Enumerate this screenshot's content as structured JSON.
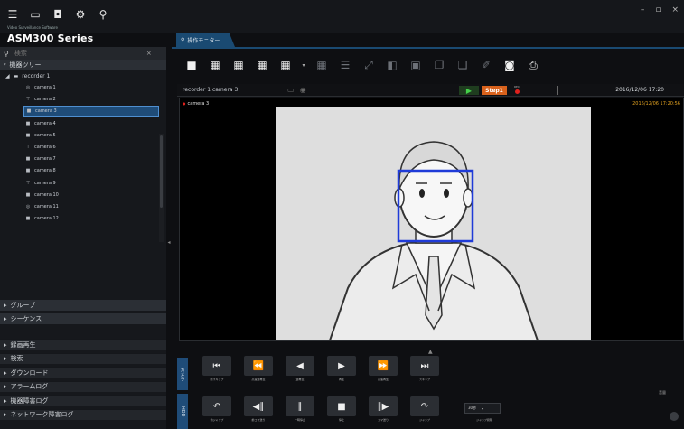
{
  "header": {
    "brand_sub": "Video Surveillance Software",
    "brand": "ASM300 Series",
    "top_icons": [
      "menu-icon",
      "monitor-icon",
      "camera-view-icon",
      "settings-icon",
      "search-icon"
    ],
    "window_controls": [
      "–",
      "▫",
      "×"
    ]
  },
  "left_panel": {
    "search_placeholder": "検索",
    "tree_header": "機器ツリー",
    "recorder": "recorder 1",
    "cameras": [
      {
        "label": "camera 1",
        "icon": "dome-camera-icon",
        "glyph": "◎"
      },
      {
        "label": "camera 2",
        "icon": "bullet-camera-icon",
        "glyph": "⊤"
      },
      {
        "label": "camera 3",
        "icon": "box-camera-icon",
        "glyph": "■",
        "selected": true
      },
      {
        "label": "camera 4",
        "icon": "box-camera-icon",
        "glyph": "■"
      },
      {
        "label": "camera 5",
        "icon": "box-camera-icon",
        "glyph": "■"
      },
      {
        "label": "camera 6",
        "icon": "bullet-camera-icon",
        "glyph": "⊤"
      },
      {
        "label": "camera 7",
        "icon": "box-camera-icon",
        "glyph": "■"
      },
      {
        "label": "camera 8",
        "icon": "box-camera-icon",
        "glyph": "■"
      },
      {
        "label": "camera 9",
        "icon": "bullet-camera-icon",
        "glyph": "⊤"
      },
      {
        "label": "camera 10",
        "icon": "box-camera-icon",
        "glyph": "■"
      },
      {
        "label": "camera 11",
        "icon": "dome-camera-icon",
        "glyph": "◎"
      },
      {
        "label": "camera 12",
        "icon": "box-camera-icon",
        "glyph": "■"
      }
    ],
    "sections": [
      "グループ",
      "シーケンス"
    ],
    "menu": [
      "録画再生",
      "検索",
      "ダウンロード",
      "アラームログ",
      "機器障害ログ",
      "ネットワーク障害ログ"
    ]
  },
  "monitor": {
    "tab_label": "操作モニター",
    "camera_info": "recorder 1 camera 3",
    "step_label": "Step1",
    "rec_label": "REC",
    "datetime": "2016/12/06 17:20",
    "overlay_camera": "camera 3",
    "overlay_datetime": "2016/12/06 17:20:56"
  },
  "toolbar": {
    "buttons": [
      {
        "name": "layout-1-icon",
        "glyph": "■",
        "dim": false
      },
      {
        "name": "layout-4-icon",
        "glyph": "▦",
        "dim": false
      },
      {
        "name": "layout-9-icon",
        "glyph": "▦",
        "dim": false
      },
      {
        "name": "layout-16-icon",
        "glyph": "▦",
        "dim": false
      },
      {
        "name": "layout-more-icon",
        "glyph": "▦",
        "dim": false
      },
      {
        "name": "layout-dropdown-icon",
        "glyph": "▾",
        "dim": false
      },
      {
        "name": "layout-wide-icon",
        "glyph": "▦",
        "dim": true
      },
      {
        "name": "layout-list-icon",
        "glyph": "☰",
        "dim": true
      },
      {
        "name": "fullscreen-icon",
        "glyph": "⤢",
        "dim": true
      },
      {
        "name": "audio-icon",
        "glyph": "◧",
        "dim": true
      },
      {
        "name": "snapshot-list-icon",
        "glyph": "▣",
        "dim": true
      },
      {
        "name": "copy-icon",
        "glyph": "❐",
        "dim": true
      },
      {
        "name": "paste-icon",
        "glyph": "❏",
        "dim": true
      },
      {
        "name": "edit-icon",
        "glyph": "✐",
        "dim": true
      },
      {
        "name": "camera-icon",
        "glyph": "◙",
        "dim": false
      },
      {
        "name": "print-icon",
        "glyph": "⎙",
        "dim": false
      }
    ]
  },
  "controls": {
    "vtab_top": "カメラ",
    "vtab_bottom": "HDD",
    "row1": [
      {
        "name": "skip-back-button",
        "glyph": "⏮",
        "label": "前スキップ"
      },
      {
        "name": "fast-reverse-button",
        "glyph": "⏪",
        "label": "高速逆再生"
      },
      {
        "name": "reverse-play-button",
        "glyph": "◀",
        "label": "逆再生"
      },
      {
        "name": "play-button",
        "glyph": "▶",
        "label": "再生"
      },
      {
        "name": "fast-forward-button",
        "glyph": "⏩",
        "label": "高速再生"
      },
      {
        "name": "skip-forward-button",
        "glyph": "⏭",
        "label": "スキップ"
      }
    ],
    "row2": [
      {
        "name": "jump-back-button",
        "glyph": "↶",
        "label": "前ジャンプ"
      },
      {
        "name": "frame-back-button",
        "glyph": "◀∥",
        "label": "前コマ送り"
      },
      {
        "name": "pause-button",
        "glyph": "∥",
        "label": "一時停止"
      },
      {
        "name": "stop-button",
        "glyph": "■",
        "label": "停止"
      },
      {
        "name": "frame-forward-button",
        "glyph": "∥▶",
        "label": "コマ送り"
      },
      {
        "name": "jump-forward-button",
        "glyph": "↷",
        "label": "ジャンプ"
      }
    ],
    "jump_interval": "30秒",
    "jump_interval_label": "ジャンプ間隔",
    "corner_label": "音量"
  }
}
